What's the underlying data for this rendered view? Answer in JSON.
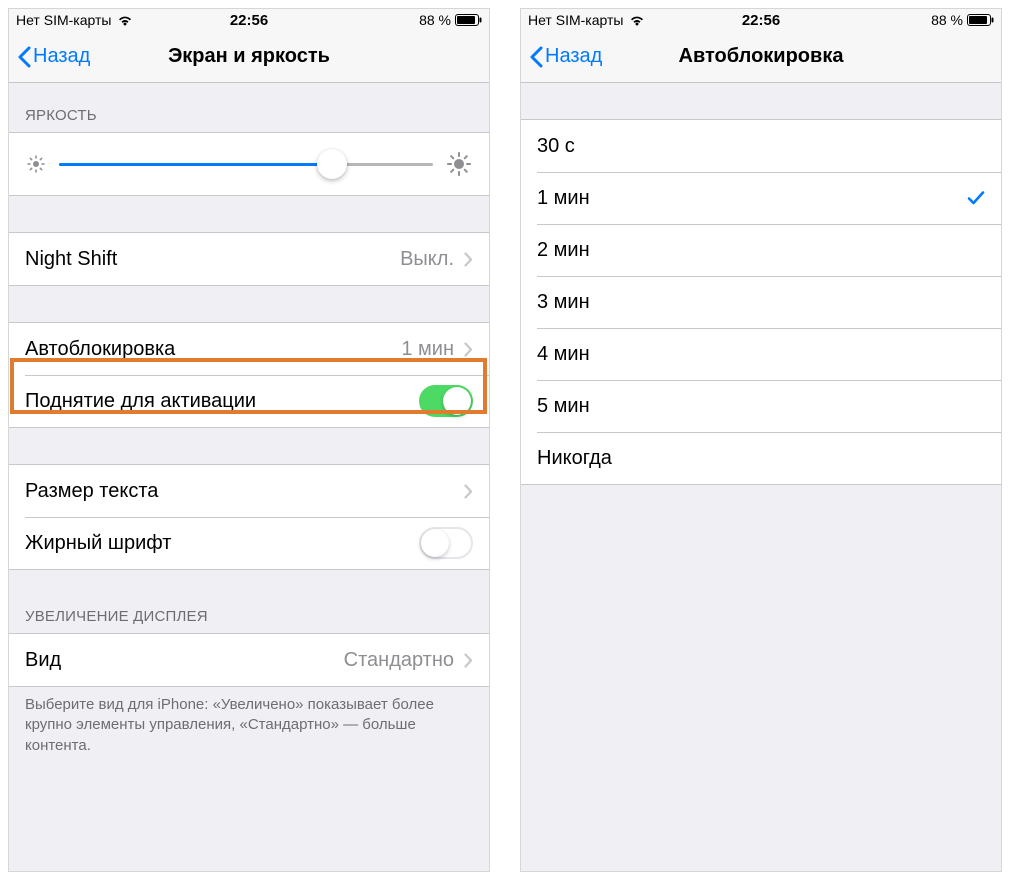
{
  "status": {
    "carrier": "Нет SIM-карты",
    "time": "22:56",
    "battery_pct": "88 %"
  },
  "left_screen": {
    "back_label": "Назад",
    "title": "Экран и яркость",
    "brightness_header": "ЯРКОСТЬ",
    "rows": {
      "night_shift": {
        "label": "Night Shift",
        "value": "Выкл."
      },
      "autolock": {
        "label": "Автоблокировка",
        "value": "1 мин"
      },
      "raise": {
        "label": "Поднятие для активации"
      },
      "textsize": {
        "label": "Размер текста"
      },
      "bold": {
        "label": "Жирный шрифт"
      }
    },
    "zoom_header": "УВЕЛИЧЕНИЕ ДИСПЛЕЯ",
    "view": {
      "label": "Вид",
      "value": "Стандартно"
    },
    "footer": "Выберите вид для iPhone: «Увеличено» показывает более крупно элементы управления, «Стандартно» — больше контента."
  },
  "right_screen": {
    "back_label": "Назад",
    "title": "Автоблокировка",
    "options": [
      {
        "label": "30 с",
        "checked": false
      },
      {
        "label": "1 мин",
        "checked": true
      },
      {
        "label": "2 мин",
        "checked": false
      },
      {
        "label": "3 мин",
        "checked": false
      },
      {
        "label": "4 мин",
        "checked": false
      },
      {
        "label": "5 мин",
        "checked": false
      },
      {
        "label": "Никогда",
        "checked": false
      }
    ]
  }
}
